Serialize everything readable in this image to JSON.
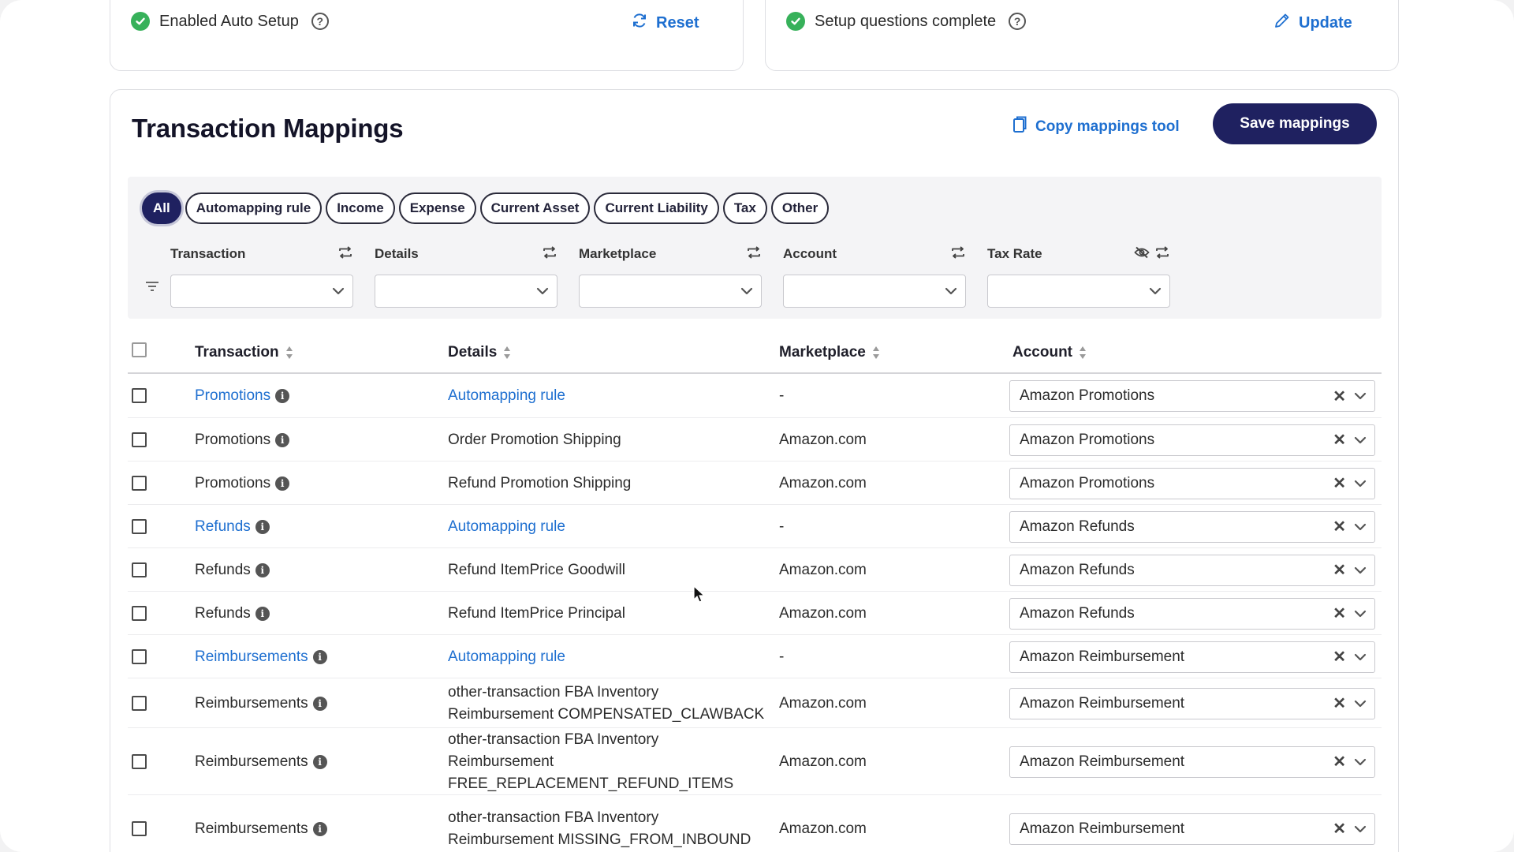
{
  "setup": {
    "auto_setup_label": "Enabled Auto Setup",
    "reset_label": "Reset",
    "questions_label": "Setup questions complete",
    "update_label": "Update"
  },
  "header": {
    "title": "Transaction Mappings",
    "copy_tool_label": "Copy mappings tool",
    "save_label": "Save mappings"
  },
  "filters": {
    "pills": [
      "All",
      "Automapping rule",
      "Income",
      "Expense",
      "Current Asset",
      "Current Liability",
      "Tax",
      "Other"
    ],
    "active_pill": "All",
    "columns": [
      "Transaction",
      "Details",
      "Marketplace",
      "Account",
      "Tax Rate"
    ]
  },
  "table": {
    "headers": [
      "Transaction",
      "Details",
      "Marketplace",
      "Account"
    ],
    "rows": [
      {
        "transaction": "Promotions",
        "details": [
          "Automapping rule"
        ],
        "marketplace": "-",
        "account": "Amazon Promotions"
      },
      {
        "transaction": "Promotions",
        "details": [
          "Order Promotion Shipping"
        ],
        "marketplace": "Amazon.com",
        "account": "Amazon Promotions"
      },
      {
        "transaction": "Promotions",
        "details": [
          "Refund Promotion Shipping"
        ],
        "marketplace": "Amazon.com",
        "account": "Amazon Promotions"
      },
      {
        "transaction": "Refunds",
        "details": [
          "Automapping rule"
        ],
        "marketplace": "-",
        "account": "Amazon Refunds"
      },
      {
        "transaction": "Refunds",
        "details": [
          "Refund ItemPrice Goodwill"
        ],
        "marketplace": "Amazon.com",
        "account": "Amazon Refunds"
      },
      {
        "transaction": "Refunds",
        "details": [
          "Refund ItemPrice Principal"
        ],
        "marketplace": "Amazon.com",
        "account": "Amazon Refunds"
      },
      {
        "transaction": "Reimbursements",
        "details": [
          "Automapping rule"
        ],
        "marketplace": "-",
        "account": "Amazon Reimbursement"
      },
      {
        "transaction": "Reimbursements",
        "details": [
          "other-transaction FBA Inventory",
          "Reimbursement COMPENSATED_CLAWBACK"
        ],
        "marketplace": "Amazon.com",
        "account": "Amazon Reimbursement"
      },
      {
        "transaction": "Reimbursements",
        "details": [
          "other-transaction FBA Inventory",
          "Reimbursement",
          "FREE_REPLACEMENT_REFUND_ITEMS"
        ],
        "marketplace": "Amazon.com",
        "account": "Amazon Reimbursement"
      },
      {
        "transaction": "Reimbursements",
        "details": [
          "other-transaction FBA Inventory",
          "Reimbursement MISSING_FROM_INBOUND"
        ],
        "marketplace": "Amazon.com",
        "account": "Amazon Reimbursement"
      }
    ]
  },
  "colors": {
    "accent": "#1e6fd0",
    "primary_button": "#1f2160",
    "success": "#37b15a"
  },
  "icons": {
    "check": "check-circle-icon",
    "help": "help-circle-icon",
    "reset": "refresh-icon",
    "update": "pencil-icon",
    "copy": "copy-icon",
    "filter": "filter-lines-icon",
    "swap": "swap-icon",
    "hide": "eye-off-icon",
    "sort": "sort-icon",
    "info": "info-icon",
    "clear": "close-icon",
    "chevron": "chevron-down-icon"
  }
}
